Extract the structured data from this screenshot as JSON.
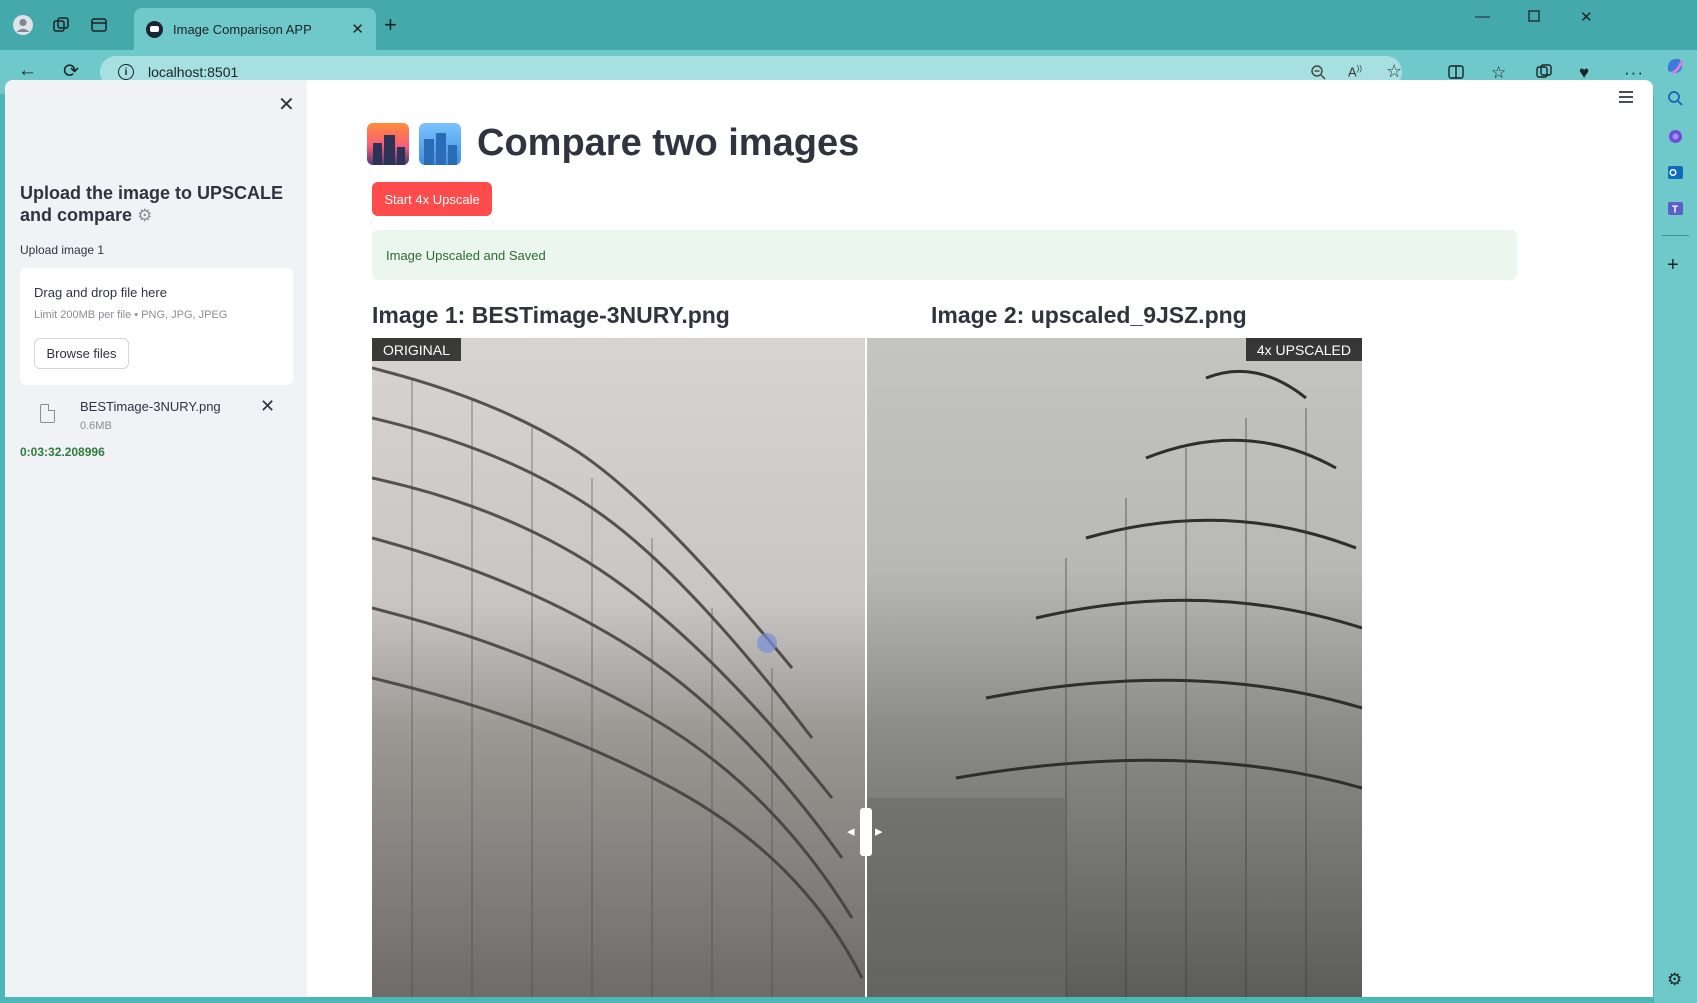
{
  "browser": {
    "tab_title": "Image Comparison APP",
    "url": "localhost:8501"
  },
  "sidebar": {
    "heading": "Upload the image to UPSCALE and compare",
    "upload_label": "Upload image 1",
    "dropzone_title": "Drag and drop file here",
    "dropzone_limit": "Limit 200MB per file • PNG, JPG, JPEG",
    "browse_label": "Browse files",
    "file_name": "BESTimage-3NURY.png",
    "file_size": "0.6MB",
    "elapsed": "0:03:32.208996"
  },
  "main": {
    "title": "Compare two images",
    "start_button": "Start 4x Upscale",
    "status_message": "Image Upscaled and Saved",
    "image1_label": "Image 1: BESTimage-3NURY.png",
    "image2_label": "Image 2: upscaled_9JSZ.png",
    "left_tag": "ORIGINAL",
    "right_tag": "4x UPSCALED"
  }
}
